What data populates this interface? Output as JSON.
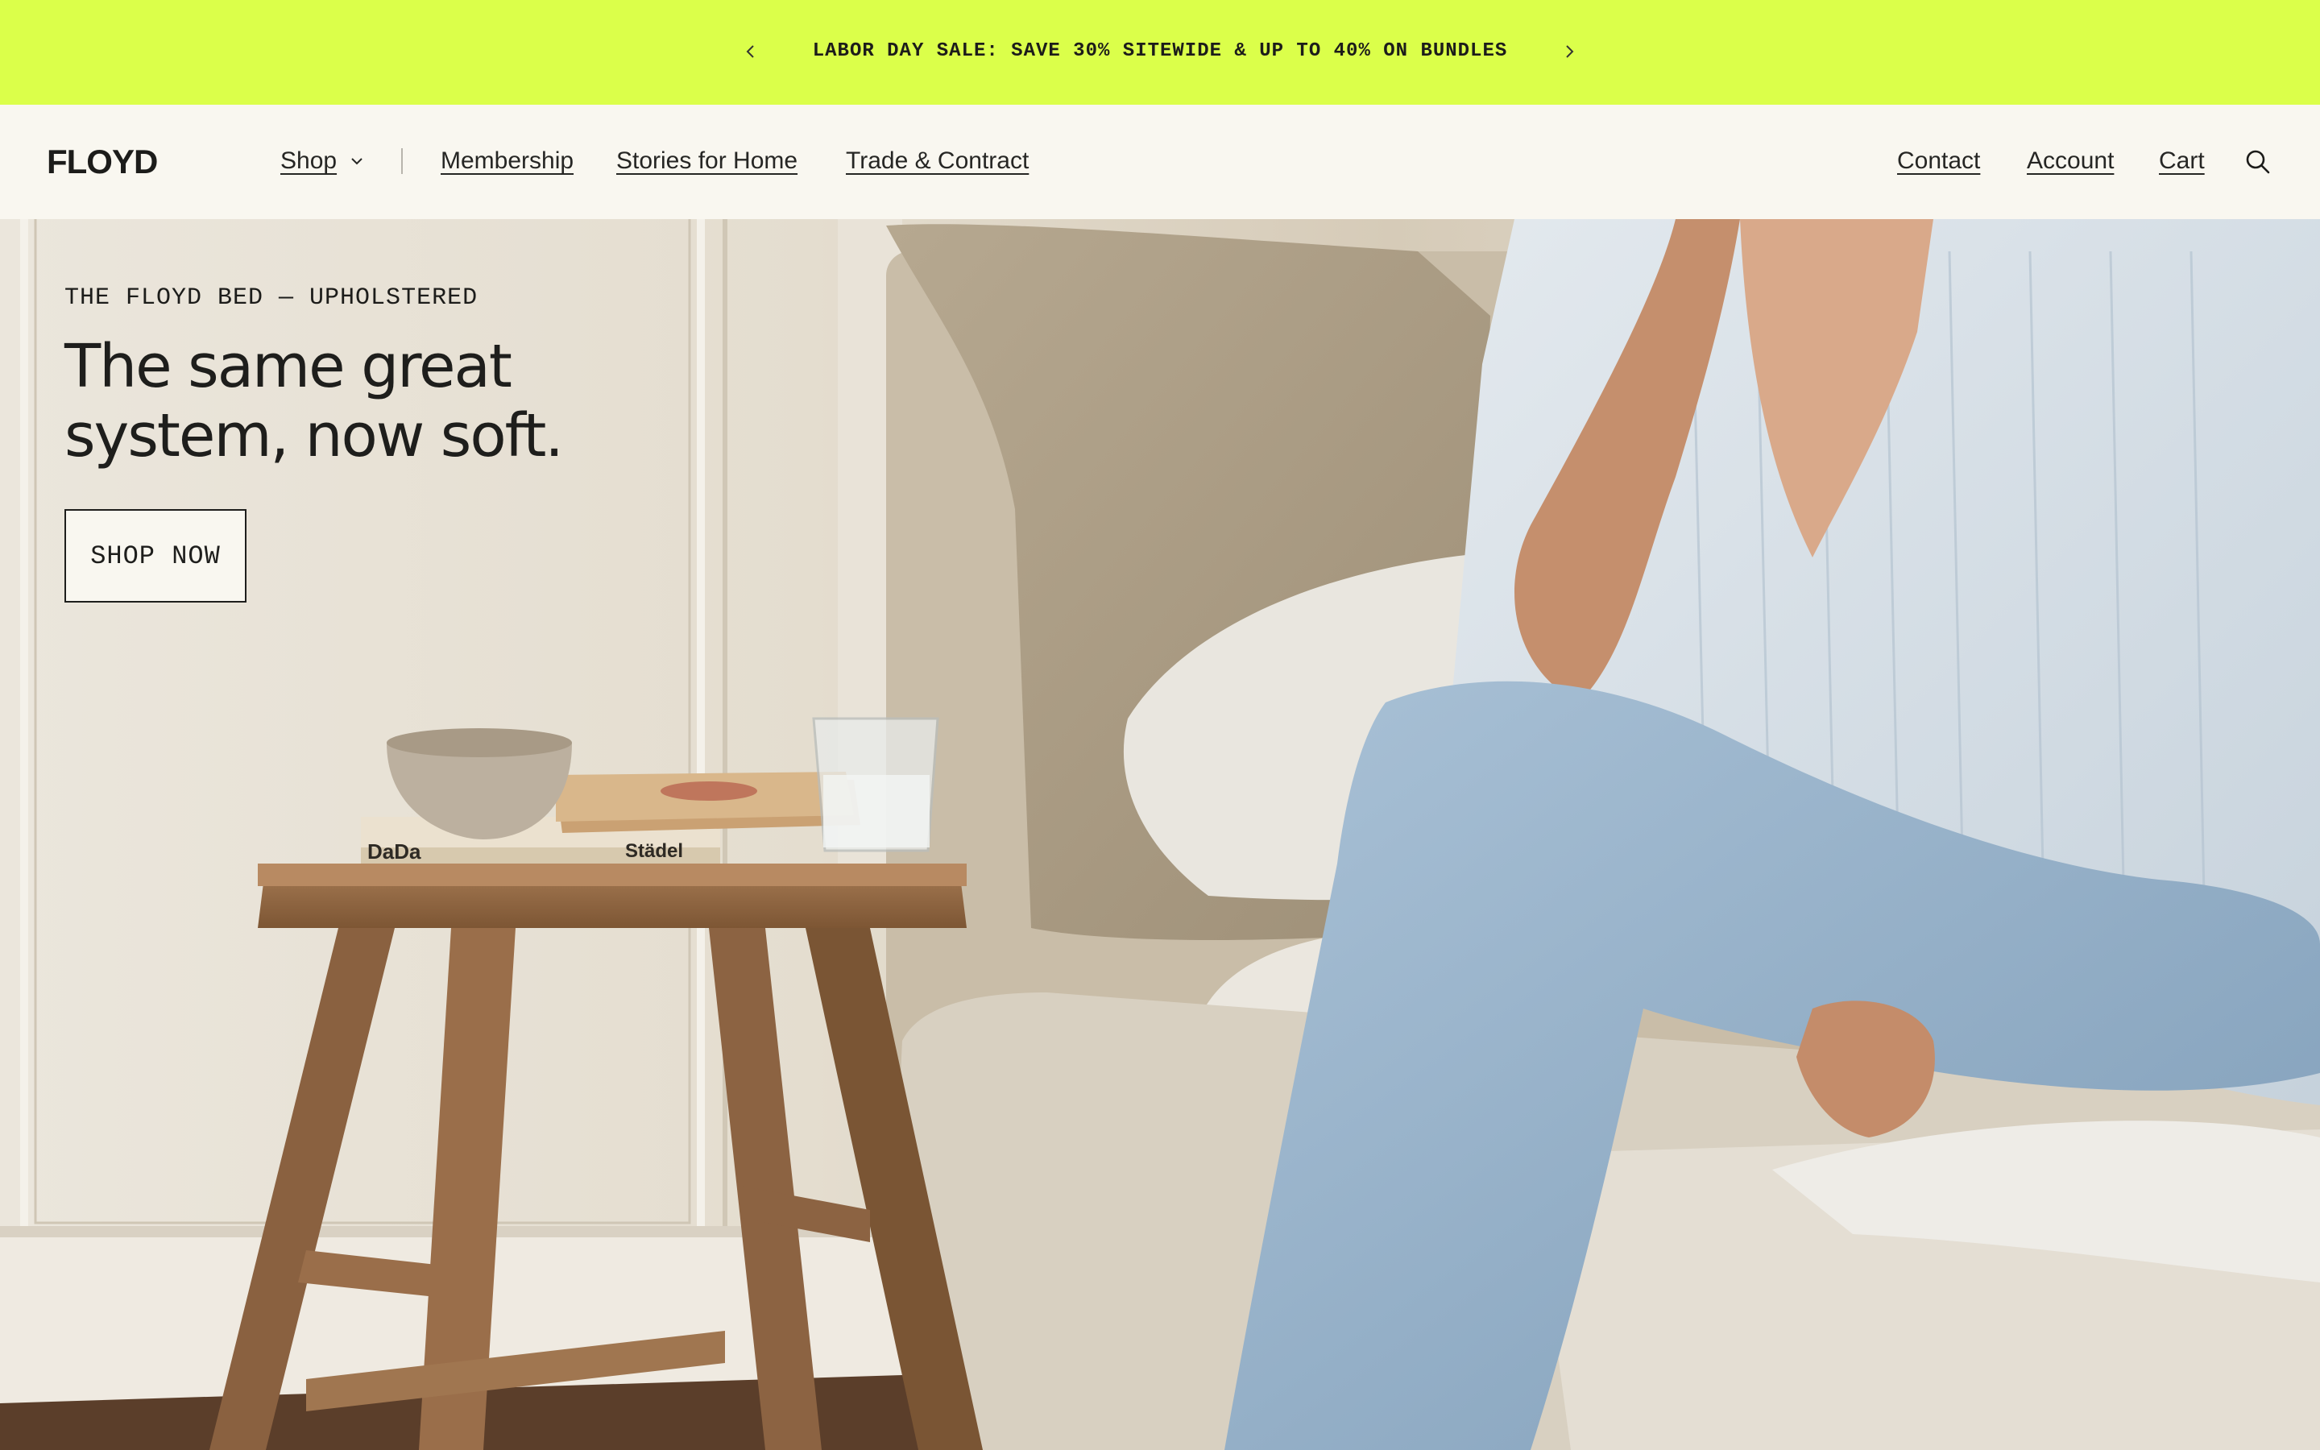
{
  "announcement": {
    "message": "LABOR DAY SALE: SAVE 30% SITEWIDE & UP TO 40% ON BUNDLES",
    "prev_icon": "chevron-left-icon",
    "next_icon": "chevron-right-icon",
    "background": "#dbff4a"
  },
  "header": {
    "logo": "FLOYD",
    "nav_left": {
      "shop": "Shop",
      "membership": "Membership",
      "stories": "Stories for Home",
      "trade": "Trade & Contract"
    },
    "nav_right": {
      "contact": "Contact",
      "account": "Account",
      "cart": "Cart"
    },
    "search_icon": "search-icon"
  },
  "hero": {
    "eyebrow": "THE FLOYD BED — UPHOLSTERED",
    "headline_line1": "The same great",
    "headline_line2": "system, now soft.",
    "cta_label": "SHOP NOW",
    "book_label_1": "DaDa",
    "book_label_2": "Städel"
  },
  "colors": {
    "page_bg": "#f9f7f0",
    "text": "#1c1c1a",
    "accent": "#dbff4a"
  }
}
